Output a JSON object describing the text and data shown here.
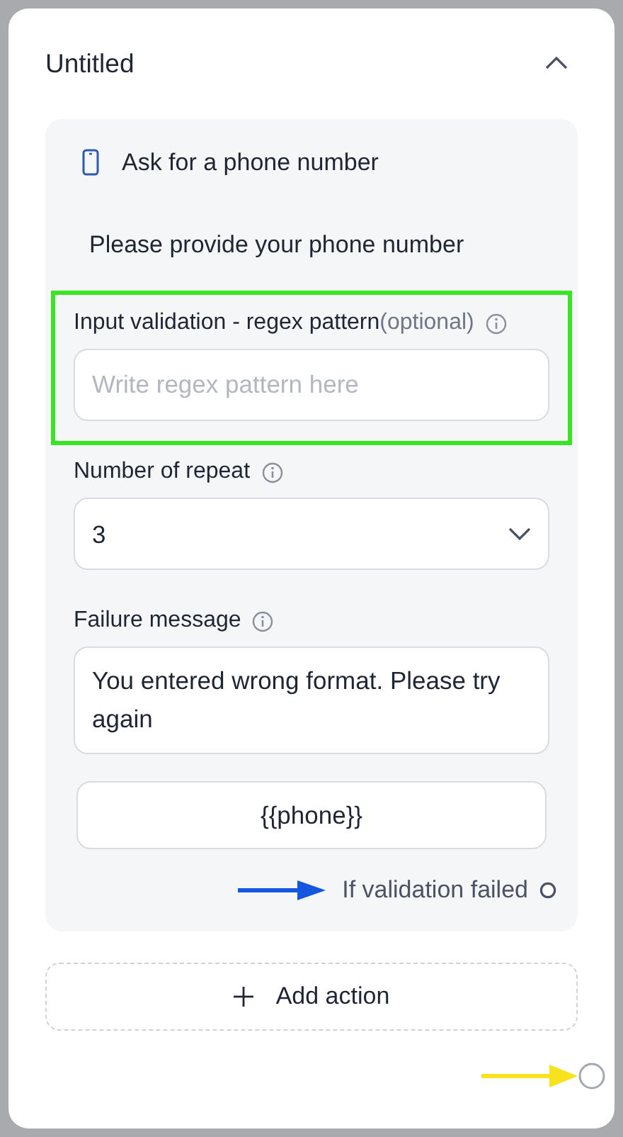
{
  "header": {
    "title": "Untitled",
    "expanded": true
  },
  "step": {
    "title": "Ask for a phone number",
    "message": "Please provide your phone number"
  },
  "fields": [
    {
      "kind": "input",
      "label": "Input validation - regex pattern",
      "optional": "(optional)",
      "placeholder": "Write regex pattern here",
      "highlighted": true
    },
    {
      "kind": "select",
      "label": "Number of repeat",
      "value": "3",
      "highlighted": false
    },
    {
      "kind": "textarea",
      "label": "Failure message",
      "value": "You entered wrong format. Please try again",
      "highlighted": false
    }
  ],
  "variable": "{{phone}}",
  "failure_output": {
    "label": "If validation failed",
    "pointed": true
  },
  "add_action": "Add action",
  "exit_connector": {
    "pointed": true
  }
}
